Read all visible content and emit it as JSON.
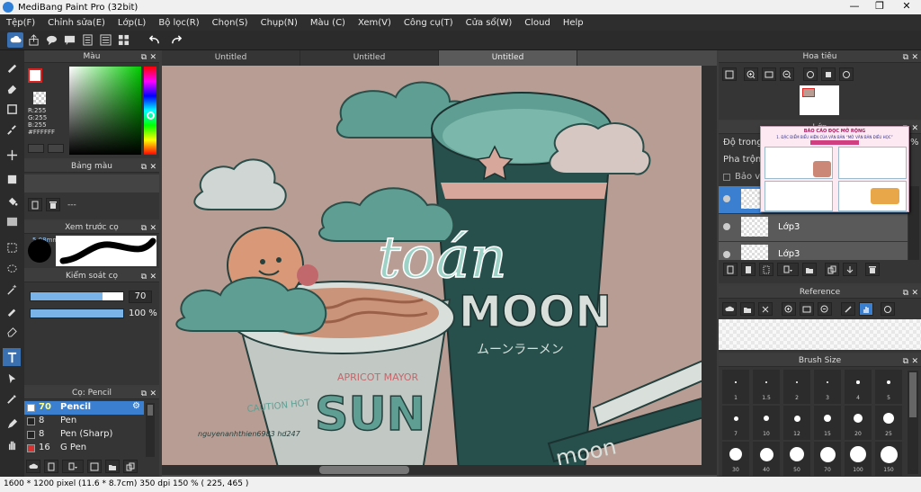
{
  "window": {
    "title": "MediBang Paint Pro (32bit)"
  },
  "menu": [
    "Tệp(F)",
    "Chỉnh sửa(E)",
    "Lớp(L)",
    "Bộ lọc(R)",
    "Chọn(S)",
    "Chụp(N)",
    "Màu (C)",
    "Xem(V)",
    "Công cụ(T)",
    "Cửa sổ(W)",
    "Cloud",
    "Help"
  ],
  "tabs": [
    "Untitled",
    "Untitled",
    "Untitled"
  ],
  "color_panel": {
    "title": "Màu",
    "r": "R:255",
    "g": "G:255",
    "b": "B:255",
    "hex": "#FFFFFF"
  },
  "palette_panel": {
    "title": "Bảng màu",
    "empty": "---"
  },
  "brush_preview": {
    "title": "Xem trước cọ",
    "size": "5.08mm"
  },
  "control_panel": {
    "title": "Kiểm soát cọ",
    "size_value": "70",
    "opacity_value": "100 %",
    "size_fraction": 0.78,
    "opacity_fraction": 1.0
  },
  "brush_panel": {
    "title": "Cọ: Pencil",
    "items": [
      {
        "size": "70",
        "name": "Pencil",
        "color": "#ffffff"
      },
      {
        "size": "8",
        "name": "Pen",
        "color": "#222222"
      },
      {
        "size": "8",
        "name": "Pen (Sharp)",
        "color": "#222222"
      },
      {
        "size": "16",
        "name": "G Pen",
        "color": "#d93030"
      }
    ]
  },
  "navigator": {
    "title": "Hoa tiêu"
  },
  "layer_panel": {
    "title": "Lớp",
    "opacity_label": "Độ trong",
    "blend_label": "Pha trộn",
    "protect_label": "Bảo vệ",
    "opacity_value": "%",
    "layers": [
      "Lớp3",
      "Lớp3"
    ]
  },
  "reference_panel": {
    "title": "Reference"
  },
  "brush_size_panel": {
    "title": "Brush Size",
    "sizes": [
      "1",
      "1.5",
      "2",
      "3",
      "4",
      "5",
      "7",
      "10",
      "12",
      "15",
      "20",
      "25",
      "30",
      "40",
      "50",
      "70",
      "100",
      "150"
    ]
  },
  "popup": {
    "title": "BÁO CÁO ĐỌC MỞ RỘNG",
    "subtitle": "1. ĐẶC ĐIỂM BIỂU HIỆN CỦA VĂN BẢN “MỞ VĂN BẢN ĐIỀU HỌC”"
  },
  "canvas_text": {
    "overlay": "toán",
    "cup1_small": "APRICOT MAYOR",
    "cup1_main": "SUN",
    "cup1_caution": "CAUTION HOT",
    "cup2_main": "MOON",
    "cup2_kana": "ムーンラーメン",
    "cup3_main": "moon",
    "signature": "nguyenanhthien6983 hd247"
  },
  "status": "1600 * 1200 pixel   (11.6 * 8.7cm)   350 dpi   150 %   ( 225, 465 )"
}
